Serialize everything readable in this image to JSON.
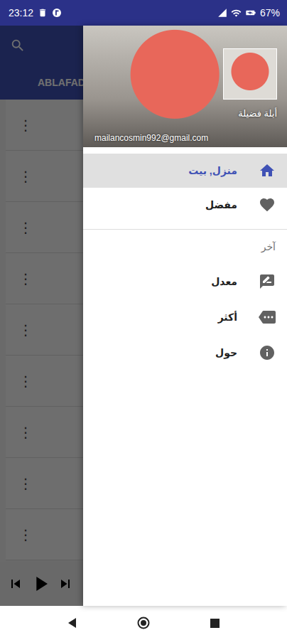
{
  "status_bar": {
    "time": "23:12",
    "battery": "67%"
  },
  "toolbar": {
    "tab": "ABLAFAD"
  },
  "list": {
    "rows": [
      {
        "menu": "⋮"
      },
      {
        "menu": "⋮"
      },
      {
        "menu": "⋮"
      },
      {
        "menu": "⋮"
      },
      {
        "menu": "⋮"
      },
      {
        "menu": "⋮"
      },
      {
        "menu": "⋮"
      },
      {
        "menu": "⋮"
      },
      {
        "menu": "⋮"
      }
    ]
  },
  "player": {
    "playing": false
  },
  "drawer": {
    "header": {
      "name": "أبلة فضيلة",
      "email": "mailancosmin992@gmail.com"
    },
    "items": [
      {
        "label": "منزل, بيت",
        "selected": true
      },
      {
        "label": "مفضل",
        "selected": false
      }
    ],
    "section": {
      "title": "آخر",
      "items": [
        {
          "label": "معدل",
          "selected": false
        },
        {
          "label": "أكثر",
          "selected": false
        },
        {
          "label": "حول",
          "selected": false
        }
      ]
    }
  }
}
